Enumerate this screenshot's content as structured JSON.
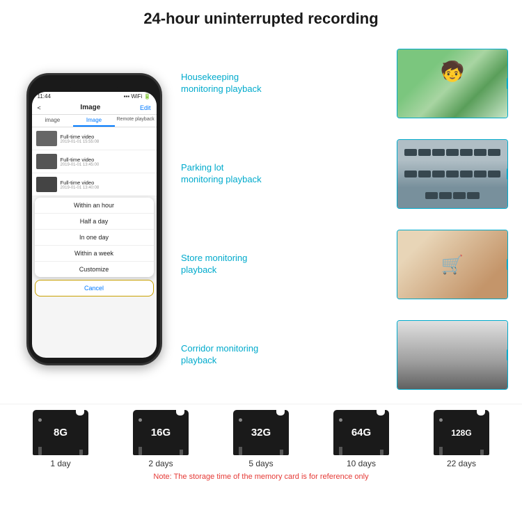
{
  "header": {
    "title": "24-hour uninterrupted recording"
  },
  "phone": {
    "time": "11:44",
    "nav_title": "Image",
    "nav_edit": "Edit",
    "nav_back": "<",
    "tabs": [
      "image",
      "Image",
      "Remote playback"
    ],
    "active_tab": 1,
    "list_items": [
      {
        "title": "Full-time video",
        "date": "2019-01-01 15:55:08"
      },
      {
        "title": "Full-time video",
        "date": "2019-01-01 13:45:00"
      },
      {
        "title": "Full-time video",
        "date": "2019-01-01 13:40:08"
      }
    ],
    "dropdown_items": [
      "Within an hour",
      "Half a day",
      "In one day",
      "Within a week",
      "Customize"
    ],
    "cancel_label": "Cancel"
  },
  "monitoring": [
    {
      "label": "Housekeeping\nmonitoring playback",
      "type": "housekeeping"
    },
    {
      "label": "Parking lot\nmonitoring playback",
      "type": "parking"
    },
    {
      "label": "Store monitoring\nplayback",
      "type": "store"
    },
    {
      "label": "Corridor monitoring\nplayback",
      "type": "corridor"
    }
  ],
  "storage": {
    "cards": [
      {
        "size": "8G",
        "days": "1 day"
      },
      {
        "size": "16G",
        "days": "2 days"
      },
      {
        "size": "32G",
        "days": "5 days"
      },
      {
        "size": "64G",
        "days": "10 days"
      },
      {
        "size": "128G",
        "days": "22 days"
      }
    ],
    "note": "Note: The storage time of the memory card is for reference only"
  }
}
